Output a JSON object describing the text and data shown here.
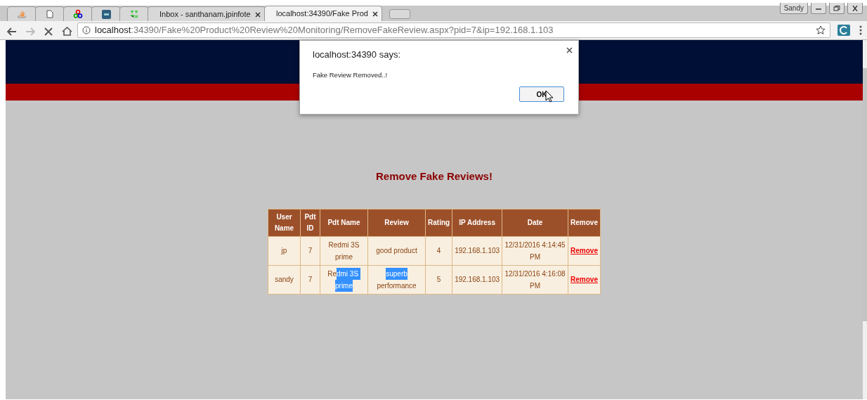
{
  "browser": {
    "tabs": [
      {
        "kind": "icon",
        "selected": false
      },
      {
        "kind": "icon",
        "selected": false
      },
      {
        "kind": "icon",
        "selected": false
      },
      {
        "kind": "icon",
        "selected": false
      },
      {
        "kind": "icon",
        "selected": false
      },
      {
        "kind": "text",
        "title": "Inbox - santhanam.jpinfote",
        "selected": false
      },
      {
        "kind": "text",
        "title": "localhost:34390/Fake Prod",
        "selected": true
      }
    ],
    "profile": "Sandy",
    "address": {
      "host": "localhost",
      "rest": ":34390/Fake%20Product%20Review%20Monitoring/RemoveFakeReview.aspx?pid=7&ip=192.168.1.103"
    }
  },
  "page": {
    "heading": "Remove Fake Reviews!",
    "table": {
      "columns": [
        "User Name",
        "Pdt ID",
        "Pdt Name",
        "Review",
        "Rating",
        "IP Address",
        "Date",
        "Remove"
      ],
      "rows": [
        {
          "user": "jp",
          "pid": "7",
          "pname": [
            {
              "text": "Redmi 3S prime",
              "highlighted": false
            }
          ],
          "review": [
            {
              "text": "good product",
              "highlighted": false
            }
          ],
          "rating": "4",
          "ip": "192.168.1.103",
          "date": "12/31/2016 4:14:45 PM",
          "link": "Remove"
        },
        {
          "user": "sandy",
          "pid": "7",
          "pname": [
            {
              "text": "Re",
              "highlighted": false
            },
            {
              "text": "dmi 3S ",
              "highlighted": true
            },
            {
              "text": "prime",
              "highlighted": true
            }
          ],
          "review": [
            {
              "text": "superb",
              "highlighted": true
            },
            {
              "text": " performance",
              "highlighted": false
            }
          ],
          "rating": "5",
          "ip": "192.168.1.103",
          "date": "12/31/2016 4:16:08 PM",
          "link": "Remove"
        }
      ]
    }
  },
  "dialog": {
    "title": "localhost:34390 says:",
    "message": "Fake Review Removed..!",
    "button": "OK"
  }
}
